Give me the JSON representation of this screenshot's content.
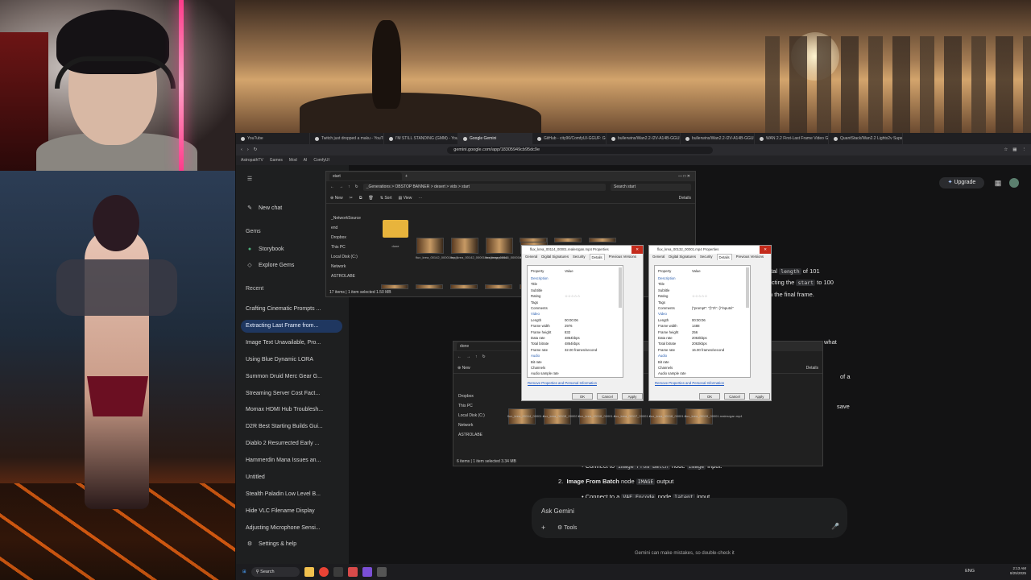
{
  "colors": {
    "gemini_bg": "#131314",
    "sidebar_bg": "#1e1f20",
    "active_recent": "#1f3760",
    "neon_pink": "#ff3b8b",
    "upgrade_accent": "#a8c7fa"
  },
  "browser": {
    "tabs": [
      {
        "label": "YouTube",
        "active": false
      },
      {
        "label": "Twitch just dropped a maku - YouTube",
        "active": false
      },
      {
        "label": "I'M STILL STANDING (GMM) - YouTube",
        "active": false
      },
      {
        "label": "Google Gemini",
        "active": true
      },
      {
        "label": "GitHub - city96/ComfyUI-GGUF: GGUF",
        "active": false
      },
      {
        "label": "bullerwins/Wan2.2-I2V-A14B-GGUF",
        "active": false
      },
      {
        "label": "bullerwins/Wan2.2-I2V-A14B-GGUF",
        "active": false
      },
      {
        "label": "WAN 2.2 First-Last Frame Video Gen",
        "active": false
      },
      {
        "label": "QuantStack/Wan2.2 Lightx2v SuperTo",
        "active": false
      }
    ],
    "url": "gemini.google.com/app/18305949cb95dc9e",
    "bookmarks": [
      "AstropathTV",
      "Games",
      "Mod",
      "AI",
      "ComfyUI"
    ]
  },
  "sidebar": {
    "new_chat": "New chat",
    "gems_heading": "Gems",
    "gems": [
      "Storybook",
      "Explore Gems"
    ],
    "recent_heading": "Recent",
    "recent": [
      "Crafting Cinematic Prompts ...",
      "Extracting Last Frame from...",
      "Image Text Unavailable, Pro...",
      "Using Blue Dynamic LORA",
      "Summon Druid Merc Gear G...",
      "Streaming Server Cost Fact...",
      "Momax HDMI Hub Troublesh...",
      "D2R Best Starting Builds Gui...",
      "Diablo 2 Resurrected Early ...",
      "Hammerdin Mana Issues an...",
      "Untitled",
      "Stealth Paladin Low Level B...",
      "Hide VLC Filename Display",
      "Adjusting Microphone Sensi..."
    ],
    "settings": "Settings & help"
  },
  "main": {
    "upgrade": "Upgrade",
    "frag": {
      "t1a": "otal",
      "t1code": "length",
      "t1b": "of 101",
      "t2a": "cting the",
      "t2code": "start",
      "t2b": "to 100",
      "t3": "h the final frame.",
      "t4": "what",
      "t5": "of a",
      "t6": "save"
    },
    "step1_sub_prefix": "Connect to",
    "step1_sub_code1": "Image From Batch",
    "step1_sub_mid": "node",
    "step1_sub_code2": "image",
    "step1_sub_suffix": "input.",
    "step2_number": "2.",
    "step2_title": "Image From Batch",
    "step2_mid": "node",
    "step2_code": "IMAGE",
    "step2_suffix": "output",
    "step2_sub_prefix": "Connect to a",
    "step2_sub_code1": "VAE Encode",
    "step2_sub_mid": "node",
    "step2_sub_code2": "latent",
    "step2_sub_suffix": "input.",
    "ask_placeholder": "Ask Gemini",
    "tools": "Tools",
    "disclaimer": "Gemini can make mistakes, so double-check it"
  },
  "explorer1": {
    "tab": "start",
    "path": "_Generations  >  OBSTOP BANNER  >  desert  >  vids  >  start",
    "search": "Search start",
    "new": "New",
    "sort": "Sort",
    "view": "View",
    "details": "Details",
    "side": [
      "_NetworkSource",
      "end",
      "Dropbox",
      "This PC",
      "Local Disk (C:)",
      "Network",
      "ASTROLABE"
    ],
    "folder_label": "done",
    "thumb_labels": [
      "flux_krea_00142_00001.mp4",
      "flux_krea_00142_00001.realesrgan.mkv",
      "flux_krea_00143_00001.mp4",
      "flux_krea_00144_00001.mp4"
    ],
    "status": "17 items  |  1 item selected  1.50 MB"
  },
  "explorer2": {
    "tab": "done",
    "new": "New",
    "details": "Details",
    "side": [
      "Dropbox",
      "This PC",
      "Local Disk (C:)",
      "Network",
      "ASTROLABE"
    ],
    "thumb_labels": [
      "flux_krea_00114_00001.realesrgan.mp4",
      "flux_krea_00115_00002.realesrgan.mp4",
      "flux_krea_00116_00001.realesrgan.mp4",
      "flux_krea_00117_00001.realesrgan.mp4",
      "flux_krea_00118_00001.realesrgan.mp4",
      "flux_krea_00119_00001.realesrgan.mp4"
    ],
    "status": "6 items  |  1 item selected  3.34 MB"
  },
  "props1": {
    "title": "flux_krea_00114_00001.realesrgan.mp4 Properties",
    "tabs": [
      "General",
      "Digital Signatures",
      "Security",
      "Details",
      "Previous Versions"
    ],
    "header": [
      "Property",
      "Value"
    ],
    "rows": [
      {
        "k": "Description",
        "v": ""
      },
      {
        "k": "Title",
        "v": ""
      },
      {
        "k": "Subtitle",
        "v": ""
      },
      {
        "k": "Rating",
        "v": "☆☆☆☆☆"
      },
      {
        "k": "Tags",
        "v": ""
      },
      {
        "k": "Comments",
        "v": ""
      },
      {
        "k": "Video",
        "v": ""
      },
      {
        "k": "Length",
        "v": "00:00:06"
      },
      {
        "k": "Frame width",
        "v": "2976"
      },
      {
        "k": "Frame height",
        "v": "832"
      },
      {
        "k": "Data rate",
        "v": "4864kbps"
      },
      {
        "k": "Total bitrate",
        "v": "4864kbps"
      },
      {
        "k": "Frame rate",
        "v": "32.00 frames/second"
      },
      {
        "k": "Audio",
        "v": ""
      },
      {
        "k": "Bit rate",
        "v": ""
      },
      {
        "k": "Channels",
        "v": ""
      },
      {
        "k": "Audio sample rate",
        "v": ""
      }
    ],
    "link": "Remove Properties and Personal Information",
    "ok": "OK",
    "cancel": "Cancel",
    "apply": "Apply"
  },
  "props2": {
    "title": "flux_krea_00132_00001.mp4 Properties",
    "tabs": [
      "General",
      "Digital Signatures",
      "Security",
      "Details",
      "Previous Versions"
    ],
    "header": [
      "Property",
      "Value"
    ],
    "rows": [
      {
        "k": "Description",
        "v": ""
      },
      {
        "k": "Title",
        "v": ""
      },
      {
        "k": "Subtitle",
        "v": ""
      },
      {
        "k": "Rating",
        "v": "☆☆☆☆☆"
      },
      {
        "k": "Tags",
        "v": ""
      },
      {
        "k": "Comments",
        "v": "{\"prompt\": \"{\\\"3\\\": {\\\"inputs\\\""
      },
      {
        "k": "Video",
        "v": ""
      },
      {
        "k": "Length",
        "v": "00:00:06"
      },
      {
        "k": "Frame width",
        "v": "1488"
      },
      {
        "k": "Frame height",
        "v": "256"
      },
      {
        "k": "Data rate",
        "v": "2063kbps"
      },
      {
        "k": "Total bitrate",
        "v": "2063kbps"
      },
      {
        "k": "Frame rate",
        "v": "16.00 frames/second"
      },
      {
        "k": "Audio",
        "v": ""
      },
      {
        "k": "Bit rate",
        "v": ""
      },
      {
        "k": "Channels",
        "v": ""
      },
      {
        "k": "Audio sample rate",
        "v": ""
      }
    ],
    "link": "Remove Properties and Personal Information",
    "ok": "OK",
    "cancel": "Cancel",
    "apply": "Apply"
  },
  "taskbar": {
    "search": "Search",
    "lang": "ENG",
    "time": "2:13 AM",
    "date": "8/25/2025"
  }
}
